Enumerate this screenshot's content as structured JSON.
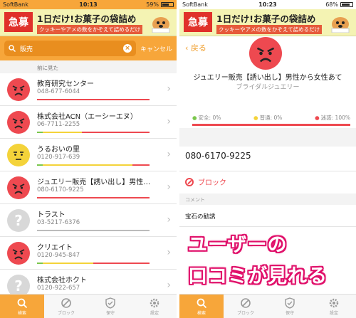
{
  "status_left": {
    "carrier": "SoftBank",
    "time": "10:13",
    "battery": "59%",
    "battery_level": 0.59
  },
  "status_right": {
    "carrier": "SoftBank",
    "time": "10:23",
    "battery": "68%",
    "battery_level": 0.68
  },
  "ad": {
    "badge": "急募",
    "headline": "1日だけ!お菓子の袋詰め",
    "sub": "クッキーやアメの数をかぞえて詰めるだけ"
  },
  "search": {
    "value": "販売",
    "cancel": "キャンセル"
  },
  "section_label": "前に見た",
  "colors": {
    "orange": "#f7a63a",
    "red": "#ee4950",
    "yellow": "#f4d33a",
    "green": "#7bc74d",
    "gray": "#d8d8d8"
  },
  "items": [
    {
      "name": "教育研究センター",
      "phone": "048-677-6044",
      "face": "angry",
      "bar": [
        0.0,
        0.0,
        1.0
      ]
    },
    {
      "name": "株式会社ACN（エーシーエヌ）",
      "phone": "06-7711-2255",
      "face": "angry",
      "bar": [
        0.05,
        0.35,
        0.6
      ]
    },
    {
      "name": "うるおいの里",
      "phone": "0120-917-639",
      "face": "neutral",
      "bar": [
        0.05,
        0.8,
        0.15
      ]
    },
    {
      "name": "ジュエリー販売【誘い出し】男性…",
      "phone": "080-6170-9225",
      "face": "angry",
      "bar": [
        0.0,
        0.0,
        1.0
      ]
    },
    {
      "name": "トラスト",
      "phone": "03-5217-6376",
      "face": "unknown",
      "bar": [
        0.0,
        0.0,
        0.0
      ]
    },
    {
      "name": "クリエイト",
      "phone": "0120-945-847",
      "face": "angry",
      "bar": [
        0.05,
        0.45,
        0.5
      ]
    },
    {
      "name": "株式会社ホクト",
      "phone": "0120-922-657",
      "face": "unknown",
      "bar": [
        0.0,
        0.0,
        0.0
      ]
    }
  ],
  "tabs": [
    {
      "label": "検索",
      "icon": "search-icon"
    },
    {
      "label": "ブロック",
      "icon": "block-icon"
    },
    {
      "label": "保守",
      "icon": "shield-icon"
    },
    {
      "label": "設定",
      "icon": "gear-icon"
    }
  ],
  "detail": {
    "back": "戻る",
    "title": "ジュエリー販売【誘い出し】男性から女性あて",
    "category": "ブライダルジュエリー",
    "stats": {
      "safe": "安全: 0%",
      "normal": "普通: 0%",
      "danger": "迷惑: 100%"
    },
    "phone": "080-6170-9225",
    "block": "ブロック",
    "comment_label": "コメント",
    "comment": "宝石の勧誘"
  },
  "overlay": {
    "line1": "ユーザーの",
    "line2": "口コミが見れる"
  }
}
